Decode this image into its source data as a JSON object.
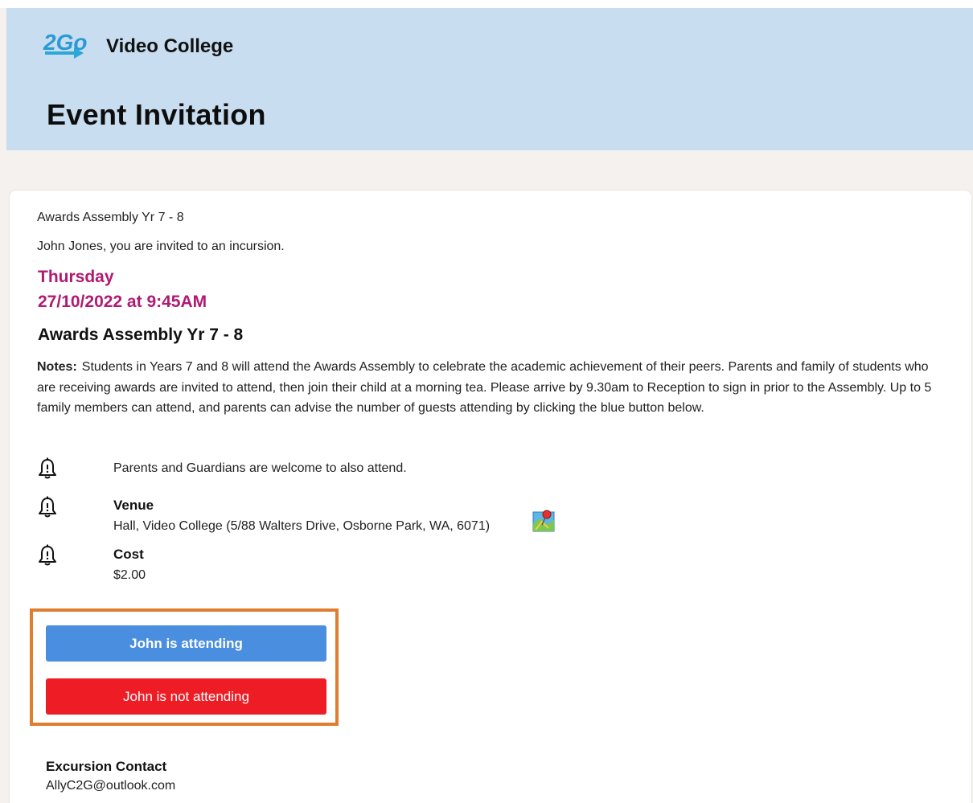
{
  "header": {
    "logo_text": "2Go",
    "brand_name": "Video College",
    "page_title": "Event Invitation"
  },
  "event": {
    "subject_line": "Awards Assembly Yr 7 - 8",
    "invite_text": "John Jones, you are invited to an incursion.",
    "day": "Thursday",
    "datetime": "27/10/2022 at 9:45AM",
    "title": "Awards Assembly Yr 7 - 8",
    "notes_label": "Notes:",
    "notes_text": "Students in Years 7 and 8 will attend the Awards Assembly to celebrate the academic achievement of their peers. Parents and family of students who are receiving awards are invited to attend, then join their child at a morning tea. Please arrive by 9.30am to Reception to sign in prior to the Assembly. Up to 5 family members can attend, and parents can advise the number of guests attending by clicking the blue button below."
  },
  "details": {
    "welcome_text": "Parents and Guardians are welcome to also attend.",
    "venue_label": "Venue",
    "venue_value": "Hall, Video College (5/88 Walters Drive, Osborne Park, WA, 6071)",
    "cost_label": "Cost",
    "cost_value": "$2.00"
  },
  "actions": {
    "attend_label": "John is attending",
    "not_attend_label": "John is not attending"
  },
  "contact": {
    "label": "Excursion Contact",
    "email": "AllyC2G@outlook.com"
  },
  "icons": {
    "logo": "2go-logo",
    "detail": "bell-icon",
    "map": "map-pin-icon"
  },
  "colors": {
    "header_bg": "#c8ddef",
    "date_accent": "#b01a72",
    "attend_button": "#4a8ee0",
    "not_attend_button": "#ee1c25",
    "highlight_border": "#e07e30"
  }
}
